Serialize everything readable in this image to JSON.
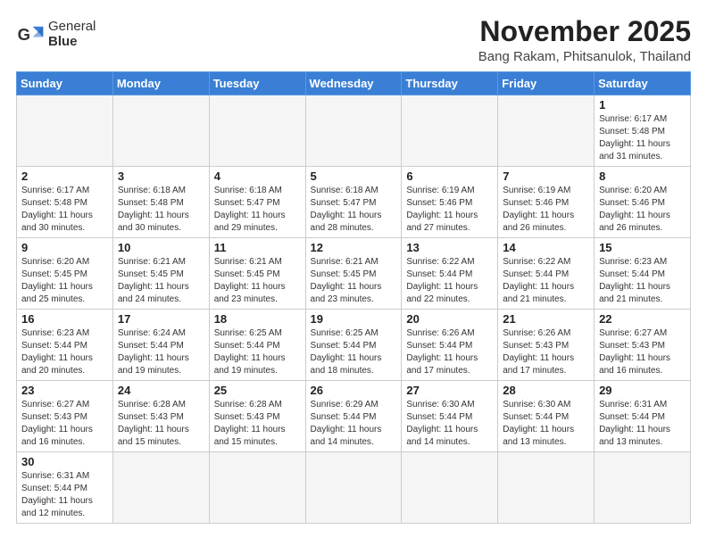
{
  "logo": {
    "text_normal": "General",
    "text_bold": "Blue"
  },
  "title": "November 2025",
  "location": "Bang Rakam, Phitsanulok, Thailand",
  "days_of_week": [
    "Sunday",
    "Monday",
    "Tuesday",
    "Wednesday",
    "Thursday",
    "Friday",
    "Saturday"
  ],
  "weeks": [
    [
      {
        "day": null,
        "info": null
      },
      {
        "day": null,
        "info": null
      },
      {
        "day": null,
        "info": null
      },
      {
        "day": null,
        "info": null
      },
      {
        "day": null,
        "info": null
      },
      {
        "day": null,
        "info": null
      },
      {
        "day": "1",
        "info": "Sunrise: 6:17 AM\nSunset: 5:48 PM\nDaylight: 11 hours\nand 31 minutes."
      }
    ],
    [
      {
        "day": "2",
        "info": "Sunrise: 6:17 AM\nSunset: 5:48 PM\nDaylight: 11 hours\nand 30 minutes."
      },
      {
        "day": "3",
        "info": "Sunrise: 6:18 AM\nSunset: 5:48 PM\nDaylight: 11 hours\nand 30 minutes."
      },
      {
        "day": "4",
        "info": "Sunrise: 6:18 AM\nSunset: 5:47 PM\nDaylight: 11 hours\nand 29 minutes."
      },
      {
        "day": "5",
        "info": "Sunrise: 6:18 AM\nSunset: 5:47 PM\nDaylight: 11 hours\nand 28 minutes."
      },
      {
        "day": "6",
        "info": "Sunrise: 6:19 AM\nSunset: 5:46 PM\nDaylight: 11 hours\nand 27 minutes."
      },
      {
        "day": "7",
        "info": "Sunrise: 6:19 AM\nSunset: 5:46 PM\nDaylight: 11 hours\nand 26 minutes."
      },
      {
        "day": "8",
        "info": "Sunrise: 6:20 AM\nSunset: 5:46 PM\nDaylight: 11 hours\nand 26 minutes."
      }
    ],
    [
      {
        "day": "9",
        "info": "Sunrise: 6:20 AM\nSunset: 5:45 PM\nDaylight: 11 hours\nand 25 minutes."
      },
      {
        "day": "10",
        "info": "Sunrise: 6:21 AM\nSunset: 5:45 PM\nDaylight: 11 hours\nand 24 minutes."
      },
      {
        "day": "11",
        "info": "Sunrise: 6:21 AM\nSunset: 5:45 PM\nDaylight: 11 hours\nand 23 minutes."
      },
      {
        "day": "12",
        "info": "Sunrise: 6:21 AM\nSunset: 5:45 PM\nDaylight: 11 hours\nand 23 minutes."
      },
      {
        "day": "13",
        "info": "Sunrise: 6:22 AM\nSunset: 5:44 PM\nDaylight: 11 hours\nand 22 minutes."
      },
      {
        "day": "14",
        "info": "Sunrise: 6:22 AM\nSunset: 5:44 PM\nDaylight: 11 hours\nand 21 minutes."
      },
      {
        "day": "15",
        "info": "Sunrise: 6:23 AM\nSunset: 5:44 PM\nDaylight: 11 hours\nand 21 minutes."
      }
    ],
    [
      {
        "day": "16",
        "info": "Sunrise: 6:23 AM\nSunset: 5:44 PM\nDaylight: 11 hours\nand 20 minutes."
      },
      {
        "day": "17",
        "info": "Sunrise: 6:24 AM\nSunset: 5:44 PM\nDaylight: 11 hours\nand 19 minutes."
      },
      {
        "day": "18",
        "info": "Sunrise: 6:25 AM\nSunset: 5:44 PM\nDaylight: 11 hours\nand 19 minutes."
      },
      {
        "day": "19",
        "info": "Sunrise: 6:25 AM\nSunset: 5:44 PM\nDaylight: 11 hours\nand 18 minutes."
      },
      {
        "day": "20",
        "info": "Sunrise: 6:26 AM\nSunset: 5:44 PM\nDaylight: 11 hours\nand 17 minutes."
      },
      {
        "day": "21",
        "info": "Sunrise: 6:26 AM\nSunset: 5:43 PM\nDaylight: 11 hours\nand 17 minutes."
      },
      {
        "day": "22",
        "info": "Sunrise: 6:27 AM\nSunset: 5:43 PM\nDaylight: 11 hours\nand 16 minutes."
      }
    ],
    [
      {
        "day": "23",
        "info": "Sunrise: 6:27 AM\nSunset: 5:43 PM\nDaylight: 11 hours\nand 16 minutes."
      },
      {
        "day": "24",
        "info": "Sunrise: 6:28 AM\nSunset: 5:43 PM\nDaylight: 11 hours\nand 15 minutes."
      },
      {
        "day": "25",
        "info": "Sunrise: 6:28 AM\nSunset: 5:43 PM\nDaylight: 11 hours\nand 15 minutes."
      },
      {
        "day": "26",
        "info": "Sunrise: 6:29 AM\nSunset: 5:44 PM\nDaylight: 11 hours\nand 14 minutes."
      },
      {
        "day": "27",
        "info": "Sunrise: 6:30 AM\nSunset: 5:44 PM\nDaylight: 11 hours\nand 14 minutes."
      },
      {
        "day": "28",
        "info": "Sunrise: 6:30 AM\nSunset: 5:44 PM\nDaylight: 11 hours\nand 13 minutes."
      },
      {
        "day": "29",
        "info": "Sunrise: 6:31 AM\nSunset: 5:44 PM\nDaylight: 11 hours\nand 13 minutes."
      }
    ],
    [
      {
        "day": "30",
        "info": "Sunrise: 6:31 AM\nSunset: 5:44 PM\nDaylight: 11 hours\nand 12 minutes."
      },
      {
        "day": null,
        "info": null
      },
      {
        "day": null,
        "info": null
      },
      {
        "day": null,
        "info": null
      },
      {
        "day": null,
        "info": null
      },
      {
        "day": null,
        "info": null
      },
      {
        "day": null,
        "info": null
      }
    ]
  ]
}
